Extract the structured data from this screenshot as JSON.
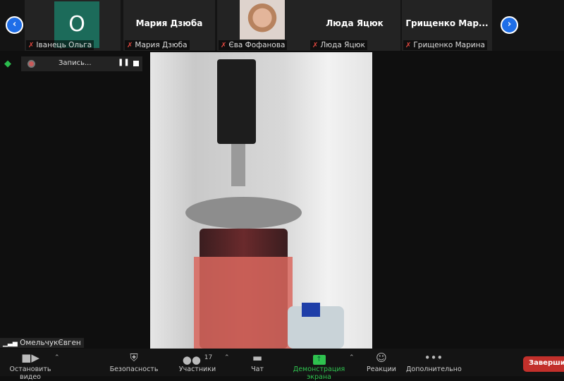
{
  "participants": [
    {
      "display": "O",
      "name": "Іванець Ольга"
    },
    {
      "display": "Мария Дзюба",
      "name": "Мария Дзюба"
    },
    {
      "display": "",
      "name": "Єва Фофанова"
    },
    {
      "display": "Люда Яцюк",
      "name": "Люда Яцюк"
    },
    {
      "display": "Грищенко  Мар...",
      "name": "Грищенко Марина"
    }
  ],
  "recording": {
    "label": "Запись..."
  },
  "self_name": "ОмельчукЄвген",
  "toolbar": {
    "video": "Остановить видео",
    "security": "Безопасность",
    "participants": "Участники",
    "participants_count": "17",
    "chat": "Чат",
    "share": "Демонстрация экрана",
    "reactions": "Реакции",
    "more": "Дополнительно",
    "end": "Завершить"
  }
}
